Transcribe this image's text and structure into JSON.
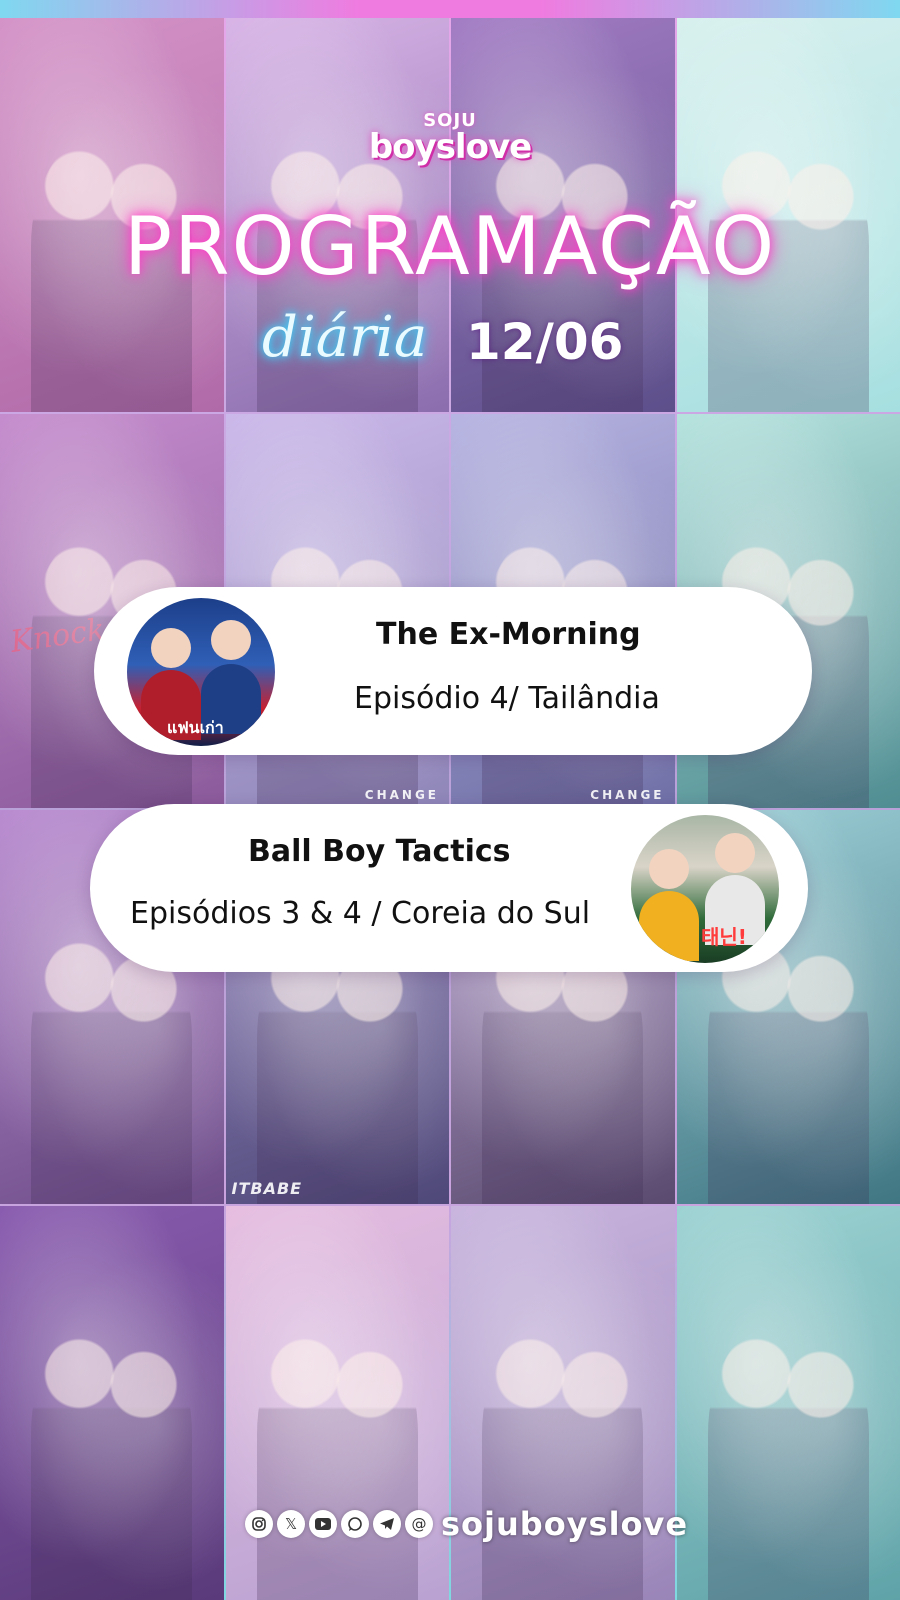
{
  "brand": {
    "small": "SOJU",
    "main": "boyslove"
  },
  "title": "PROGRAMAÇÃO",
  "subtitle": {
    "script": "diária",
    "date": "12/06"
  },
  "background": {
    "tile_captions": [
      "Knock Out",
      "CHANGE",
      "CHANGE",
      "ITBABE"
    ]
  },
  "shows": [
    {
      "title": "The Ex-Morning",
      "episode": "Episódio 4/ Tailândia",
      "poster_text": "แฟนเก่า"
    },
    {
      "title": "Ball Boy Tactics",
      "episode": "Episódios 3 & 4 / Coreia do Sul",
      "poster_text": "태닌!"
    }
  ],
  "footer": {
    "icons": [
      "instagram-icon",
      "x-icon",
      "youtube-icon",
      "whatsapp-icon",
      "telegram-icon",
      "threads-icon"
    ],
    "handle": "sojuboyslove"
  },
  "colors": {
    "neon_pink": "#ff3cc8",
    "neon_cyan": "#36d6ff",
    "card_bg": "#ffffff"
  }
}
